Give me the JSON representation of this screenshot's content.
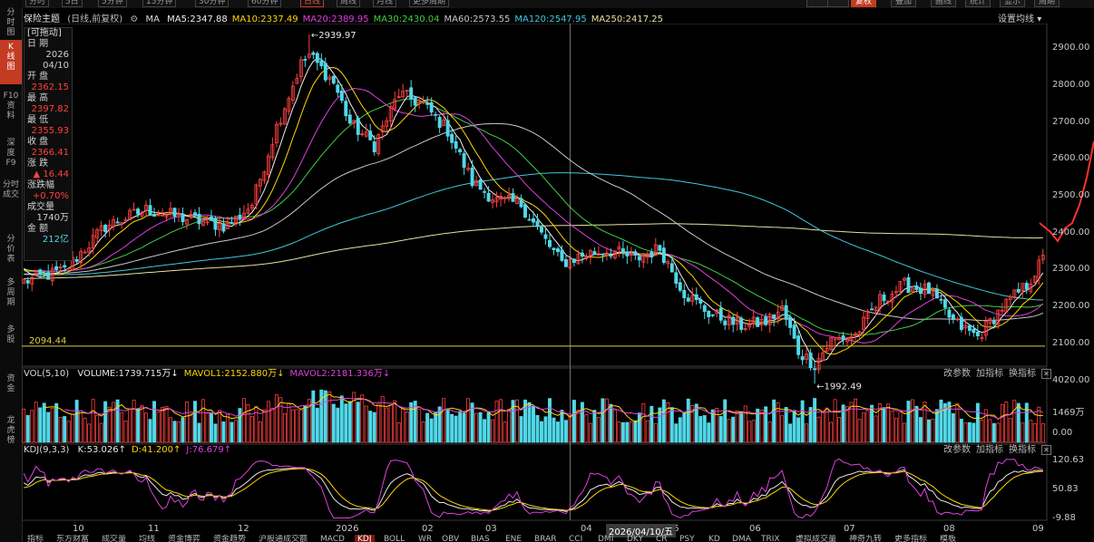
{
  "top_periods": [
    "分时",
    "5日",
    "5分钟",
    "15分钟",
    "30分钟",
    "60分钟",
    "日线",
    "周线",
    "月线",
    "更多周期"
  ],
  "top_periods_active": "日线",
  "top_right_tabs": [
    "",
    "",
    "复权",
    "叠加",
    "画线",
    "统计",
    "显示",
    "周期"
  ],
  "left_nav": [
    "分\n时\n图",
    "K\n线\n图",
    "F10\n资\n料",
    "深\n度\nF9",
    "分时\n成交",
    "分\n价\n表",
    "多\n周\n期",
    "多\n股",
    "资\n金",
    "龙\n虎\n榜"
  ],
  "left_nav_active": "K\n线\n图",
  "header": {
    "title": "保险主题",
    "subtitle": "(日线,前复权)",
    "settings_icon": "gear-icon",
    "ma_label": "MA",
    "ma": [
      {
        "text": "MA5:2347.88",
        "color": "#f0f0f0"
      },
      {
        "text": "MA10:2337.49",
        "color": "#ffd800"
      },
      {
        "text": "MA20:2389.95",
        "color": "#e040e0"
      },
      {
        "text": "MA30:2430.04",
        "color": "#40d040"
      },
      {
        "text": "MA60:2573.55",
        "color": "#c8c8c8"
      },
      {
        "text": "MA120:2547.95",
        "color": "#40c8e0"
      },
      {
        "text": "MA250:2417.25",
        "color": "#e8e0a0"
      }
    ],
    "ma_settings": "设置均线"
  },
  "info_panel": {
    "drag": "[可拖动]",
    "rows": [
      {
        "label": "日 期",
        "value": "2026\n04/10",
        "cls": "wt"
      },
      {
        "label": "开 盘",
        "value": "2362.15",
        "cls": "up"
      },
      {
        "label": "最 高",
        "value": "2397.82",
        "cls": "up"
      },
      {
        "label": "最 低",
        "value": "2355.93",
        "cls": "up"
      },
      {
        "label": "收 盘",
        "value": "2366.41",
        "cls": "up"
      },
      {
        "label": "涨 跌",
        "value": "▲ 16.44",
        "cls": "up"
      },
      {
        "label": "涨跌幅",
        "value": "+0.70%",
        "cls": "up"
      },
      {
        "label": "成交量",
        "value": "1740万",
        "cls": "wt"
      },
      {
        "label": "金 额",
        "value": "212亿",
        "cls": "cy"
      }
    ]
  },
  "price_axis": [
    "2900.00",
    "2800.00",
    "2700.00",
    "2600.00",
    "2500.00",
    "2400.00",
    "2300.00",
    "2200.00",
    "2100.00"
  ],
  "annotations": {
    "high": "←2939.97",
    "low": "←1992.49",
    "support": "2094.44"
  },
  "volume_panel": {
    "title": "VOL(5,10)",
    "items": [
      {
        "text": "VOLUME:1739.715万↓",
        "color": "#e8e8e8"
      },
      {
        "text": "MAVOL1:2152.880万↓",
        "color": "#ffd800"
      },
      {
        "text": "MAVOL2:2181.336万↓",
        "color": "#e040e0"
      }
    ],
    "right": [
      "改参数",
      "加指标",
      "换指标",
      "✕"
    ],
    "axis": [
      "4020.00",
      "1469万",
      "0.00"
    ]
  },
  "kdj_panel": {
    "title": "KDJ(9,3,3)",
    "items": [
      {
        "text": "K:53.026↑",
        "color": "#e8e8e8"
      },
      {
        "text": "D:41.200↑",
        "color": "#ffd800"
      },
      {
        "text": "J:76.679↑",
        "color": "#e040e0"
      }
    ],
    "right": [
      "改参数",
      "加指标",
      "换指标",
      "✕"
    ],
    "axis": [
      "120.63",
      "50.83",
      "-9.88"
    ]
  },
  "x_axis": [
    "10",
    "11",
    "12",
    "2026",
    "02",
    "03",
    "04",
    "05",
    "06",
    "07",
    "08",
    "09"
  ],
  "cursor_date": "2026/04/10/五",
  "bottom_tabs": [
    "指标",
    "东方财富",
    "成交量",
    "均线",
    "资金博弈",
    "资金趋势",
    "沪股通成交额",
    "MACD",
    "KDJ",
    "BOLL",
    "WR",
    "OBV",
    "BIAS",
    "ENE",
    "BRAR",
    "CCI",
    "DMI",
    "DKY",
    "CR",
    "PSY",
    "KD",
    "DMA",
    "TRIX",
    "虚拟成交量",
    "神奇九转",
    "更多指标",
    "模板"
  ],
  "bottom_tabs_active": "KDJ",
  "colors": {
    "up": "#ff4040",
    "down": "#50d8e8",
    "support": "#d8d040",
    "bg": "#000000"
  },
  "chart_data": {
    "type": "candlestick",
    "price_range": [
      1992.49,
      2939.97
    ],
    "price_anchors": [
      [
        0,
        2270
      ],
      [
        10,
        2300
      ],
      [
        20,
        2420
      ],
      [
        30,
        2465
      ],
      [
        40,
        2440
      ],
      [
        50,
        2420
      ],
      [
        56,
        2480
      ],
      [
        62,
        2690
      ],
      [
        68,
        2860
      ],
      [
        70,
        2885
      ],
      [
        76,
        2810
      ],
      [
        80,
        2700
      ],
      [
        86,
        2640
      ],
      [
        92,
        2780
      ],
      [
        98,
        2750
      ],
      [
        104,
        2680
      ],
      [
        110,
        2540
      ],
      [
        116,
        2490
      ],
      [
        122,
        2480
      ],
      [
        128,
        2380
      ],
      [
        132,
        2320
      ],
      [
        138,
        2345
      ],
      [
        144,
        2355
      ],
      [
        150,
        2330
      ],
      [
        156,
        2360
      ],
      [
        162,
        2240
      ],
      [
        168,
        2185
      ],
      [
        176,
        2150
      ],
      [
        182,
        2160
      ],
      [
        186,
        2195
      ],
      [
        190,
        2080
      ],
      [
        194,
        2045
      ],
      [
        198,
        2110
      ],
      [
        204,
        2125
      ],
      [
        210,
        2220
      ],
      [
        216,
        2260
      ],
      [
        222,
        2245
      ],
      [
        228,
        2160
      ],
      [
        234,
        2120
      ],
      [
        240,
        2200
      ],
      [
        246,
        2260
      ],
      [
        250,
        2330
      ]
    ],
    "ma_lines": [
      {
        "name": "MA5",
        "color": "#f0f0f0",
        "window": 5
      },
      {
        "name": "MA10",
        "color": "#ffd800",
        "window": 10
      },
      {
        "name": "MA20",
        "color": "#e040e0",
        "window": 20
      },
      {
        "name": "MA30",
        "color": "#40d040",
        "window": 30
      },
      {
        "name": "MA60",
        "color": "#c8c8c8",
        "window": 60
      },
      {
        "name": "MA120",
        "color": "#40c8e0",
        "window": 120
      },
      {
        "name": "MA250",
        "color": "#e8e0a0",
        "window": 250
      }
    ],
    "support_line": 2094.44,
    "volume_range": [
      0,
      4020
    ],
    "kdj_range": [
      -9.88,
      120.63
    ]
  }
}
